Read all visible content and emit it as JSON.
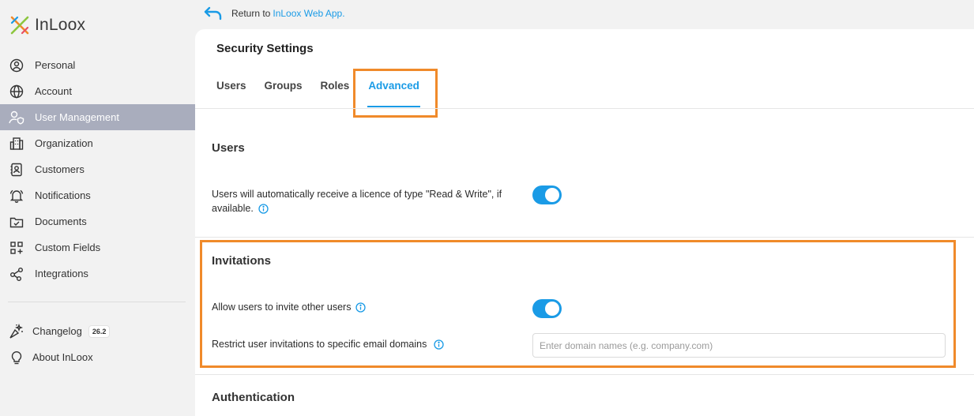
{
  "app": {
    "logo_text": "InLoox",
    "accent_color": "#1a9be6",
    "highlight_color": "#f08a2a"
  },
  "topbar": {
    "return_prefix": "Return to",
    "return_link": "InLoox Web App."
  },
  "sidebar": {
    "items": [
      {
        "label": "Personal",
        "icon": "person-circle-icon"
      },
      {
        "label": "Account",
        "icon": "globe-icon"
      },
      {
        "label": "User Management",
        "icon": "user-shield-icon",
        "active": true
      },
      {
        "label": "Organization",
        "icon": "building-icon"
      },
      {
        "label": "Customers",
        "icon": "contact-book-icon"
      },
      {
        "label": "Notifications",
        "icon": "bell-icon"
      },
      {
        "label": "Documents",
        "icon": "folder-check-icon"
      },
      {
        "label": "Custom Fields",
        "icon": "grid-plus-icon"
      },
      {
        "label": "Integrations",
        "icon": "share-nodes-icon"
      }
    ],
    "secondary": [
      {
        "label": "Changelog",
        "icon": "sparkle-icon",
        "badge": "26.2"
      },
      {
        "label": "About InLoox",
        "icon": "lightbulb-icon"
      }
    ]
  },
  "main": {
    "title": "Security Settings",
    "tabs": [
      {
        "label": "Users"
      },
      {
        "label": "Groups"
      },
      {
        "label": "Roles"
      },
      {
        "label": "Advanced",
        "active": true
      }
    ],
    "sections": {
      "users": {
        "title": "Users",
        "licence_label": "Users will automatically receive a licence of type \"Read & Write\", if available.",
        "licence_enabled": true
      },
      "invitations": {
        "title": "Invitations",
        "allow_label": "Allow users to invite other users",
        "allow_enabled": true,
        "restrict_label": "Restrict user invitations to specific email domains",
        "domain_value": "",
        "domain_placeholder": "Enter domain names (e.g. company.com)"
      },
      "authentication": {
        "title": "Authentication"
      }
    }
  }
}
